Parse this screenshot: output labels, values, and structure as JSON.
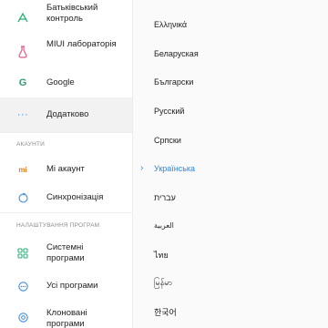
{
  "left": {
    "items_top": [
      {
        "label": "Батьківський контроль",
        "icon": "parental-control-icon",
        "color": "#2db07a"
      },
      {
        "label": "MIUI лабораторія",
        "icon": "flask-icon",
        "color": "#e05a8c"
      },
      {
        "label": "Google",
        "icon": "google-icon",
        "color": "#2f9e6e"
      },
      {
        "label": "Додатково",
        "icon": "more-dots-icon",
        "color": "#4a8fe0"
      }
    ],
    "section_accounts": "АКАУНТИ",
    "accounts": [
      {
        "label": "Мі акаунт",
        "icon": "mi-icon",
        "color": "#f07b1d"
      },
      {
        "label": "Синхронізація",
        "icon": "sync-icon",
        "color": "#3a8ee6"
      }
    ],
    "section_apps": "НАЛАШТУВАННЯ ПРОГРАМ",
    "apps": [
      {
        "label": "Системні програми",
        "icon": "system-apps-icon",
        "color": "#2db07a"
      },
      {
        "label": "Усі програми",
        "icon": "all-apps-icon",
        "color": "#3a8ee6"
      },
      {
        "label": "Клоновані програми",
        "icon": "dual-apps-icon",
        "color": "#3a8ee6"
      }
    ]
  },
  "languages": [
    "Ελληνικά",
    "Беларуская",
    "Български",
    "Русский",
    "Српски",
    "Українська",
    "עברית",
    "العربية",
    "ไทย",
    "မြန်မာ",
    "한국어"
  ],
  "selected_language": "Українська",
  "colors": {
    "accent": "#2a86e0"
  }
}
